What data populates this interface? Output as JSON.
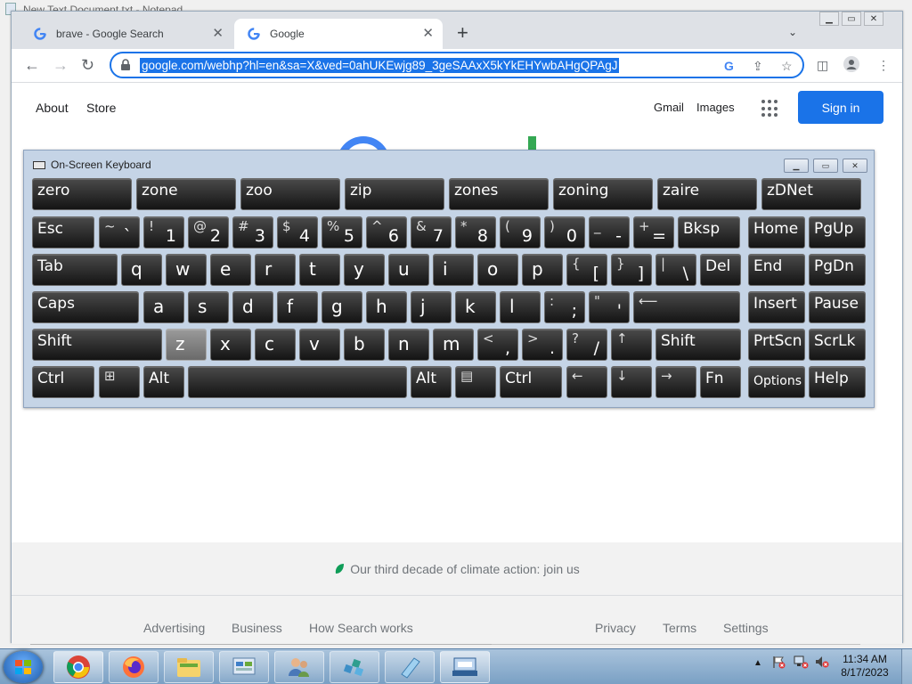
{
  "background_window": {
    "title": "New Text Document.txt - Notepad"
  },
  "browser": {
    "tabs": [
      {
        "label": "brave - Google Search",
        "active": false
      },
      {
        "label": "Google",
        "active": true
      }
    ],
    "new_tab": "+",
    "address": "google.com/webhp?hl=en&sa=X&ved=0ahUKEwjg89_3geSAAxX5kYkEHYwbAHgQPAgJ"
  },
  "page": {
    "top_left_links": [
      "About",
      "Store"
    ],
    "top_right_links": [
      "Gmail",
      "Images"
    ],
    "sign_in": "Sign in",
    "footer_message": "Our third decade of climate action: join us",
    "footer_left": [
      "Advertising",
      "Business",
      "How Search works"
    ],
    "footer_right": [
      "Privacy",
      "Terms",
      "Settings"
    ]
  },
  "osk": {
    "title": "On-Screen Keyboard",
    "predictions": [
      "zero",
      "zone",
      "zoo",
      "zip",
      "zones",
      "zoning",
      "zaire",
      "zDNet"
    ],
    "row1": [
      {
        "s": "",
        "m": "Esc"
      },
      {
        "s": "~",
        "m": "`"
      },
      {
        "s": "!",
        "m": "1"
      },
      {
        "s": "@",
        "m": "2"
      },
      {
        "s": "#",
        "m": "3"
      },
      {
        "s": "$",
        "m": "4"
      },
      {
        "s": "%",
        "m": "5"
      },
      {
        "s": "^",
        "m": "6"
      },
      {
        "s": "&",
        "m": "7"
      },
      {
        "s": "*",
        "m": "8"
      },
      {
        "s": "(",
        "m": "9"
      },
      {
        "s": ")",
        "m": "0"
      },
      {
        "s": "_",
        "m": "-"
      },
      {
        "s": "+",
        "m": "="
      },
      {
        "s": "",
        "m": "Bksp"
      },
      {
        "s": "",
        "m": "Home"
      },
      {
        "s": "",
        "m": "PgUp"
      }
    ],
    "row2": [
      "Tab",
      "q",
      "w",
      "e",
      "r",
      "t",
      "y",
      "u",
      "i",
      "o",
      "p",
      "[",
      "]",
      "\\",
      "Del",
      "End",
      "PgDn"
    ],
    "row2_shift": {
      "[": "{",
      "]": "}",
      "\\": "|"
    },
    "row3": [
      "Caps",
      "a",
      "s",
      "d",
      "f",
      "g",
      "h",
      "j",
      "k",
      "l",
      ";",
      "'",
      "",
      "Insert",
      "Pause"
    ],
    "row3_shift": {
      ";": ":",
      "'": "\""
    },
    "row4": [
      "Shift",
      "z",
      "x",
      "c",
      "v",
      "b",
      "n",
      "m",
      ",",
      ".",
      "/",
      "",
      "Shift",
      "PrtScn",
      "ScrLk"
    ],
    "row4_shift": {
      ",": "<",
      ".": ">",
      "/": "?"
    },
    "row5": [
      "Ctrl",
      "",
      "Alt",
      "",
      "Alt",
      "",
      "Ctrl",
      "",
      "",
      "",
      "Fn",
      "Options",
      "Help"
    ],
    "highlighted_key": "z"
  },
  "taskbar": {
    "time": "11:34 AM",
    "date": "8/17/2023"
  },
  "colors": {
    "accent": "#1a73e8",
    "osk_bg": "#c5d4e6",
    "key": "#1e1e1e"
  }
}
